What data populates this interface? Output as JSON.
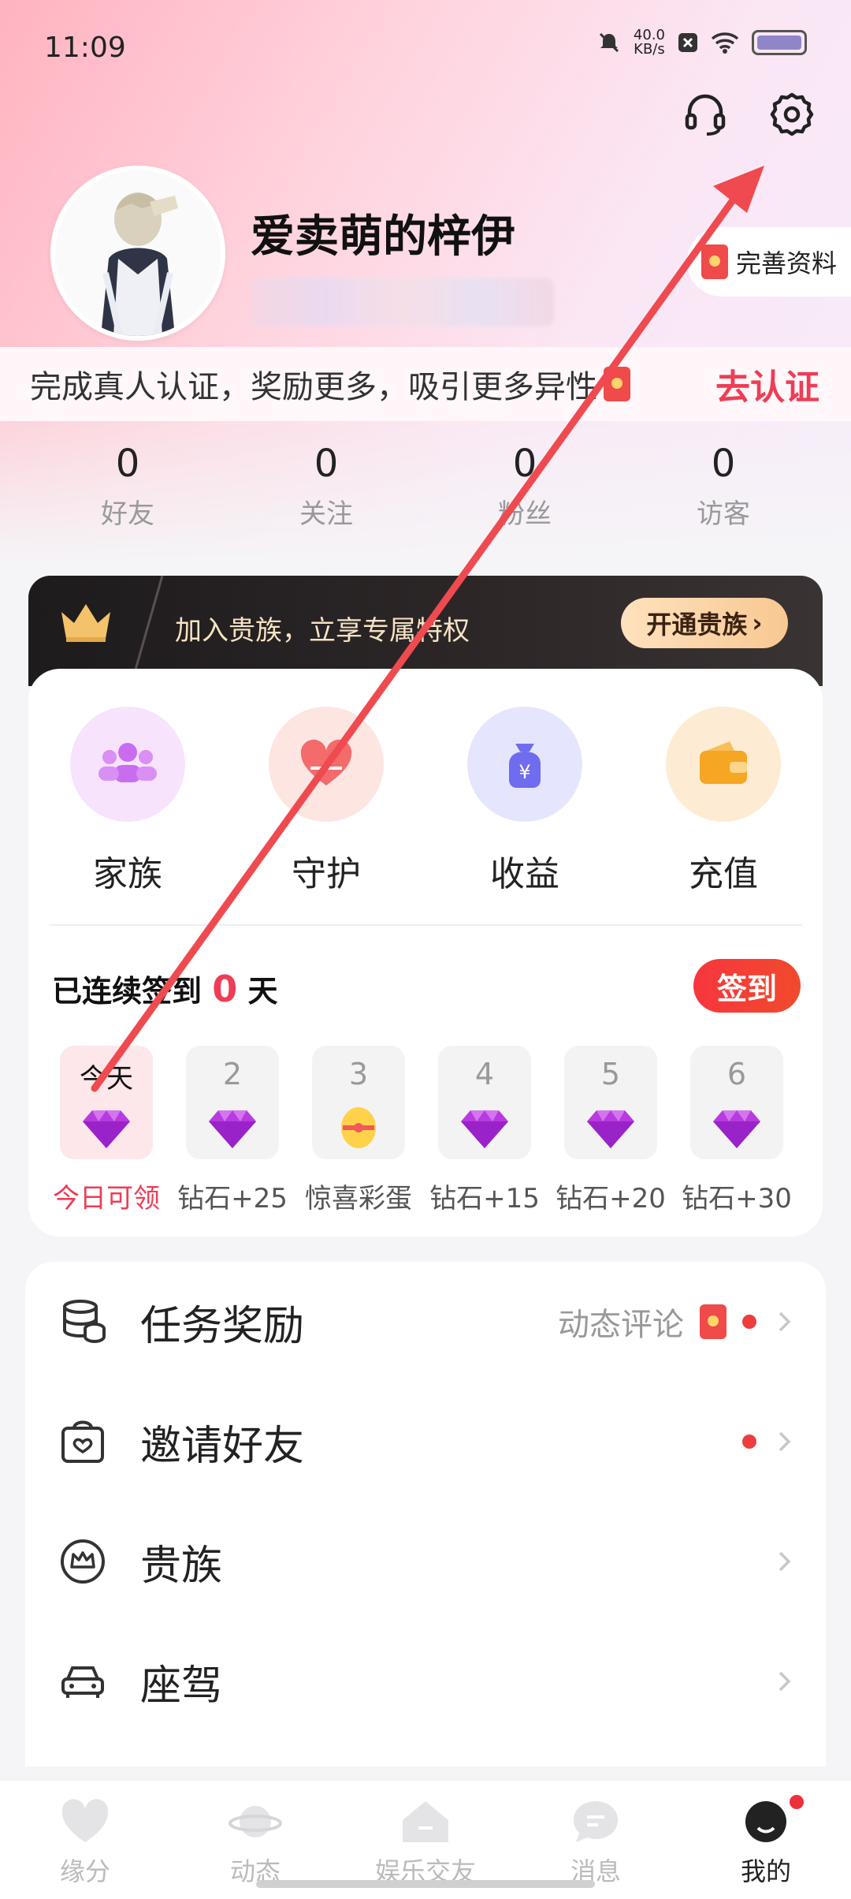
{
  "status_bar": {
    "time": "11:09",
    "net_speed_value": "40.0",
    "net_speed_unit": "KB/s"
  },
  "profile": {
    "username": "爱卖萌的梓伊",
    "complete_profile_label": "完善资料"
  },
  "verify": {
    "text": "完成真人认证，奖励更多，吸引更多异性",
    "link": "去认证"
  },
  "stats": [
    {
      "num": "0",
      "label": "好友"
    },
    {
      "num": "0",
      "label": "关注"
    },
    {
      "num": "0",
      "label": "粉丝"
    },
    {
      "num": "0",
      "label": "访客"
    }
  ],
  "noble": {
    "text": "加入贵族，立享专属特权",
    "button": "开通贵族"
  },
  "features": [
    {
      "label": "家族",
      "icon": "family-icon",
      "color": "#c96df0"
    },
    {
      "label": "守护",
      "icon": "guard-heart-icon",
      "color": "#f36b6b"
    },
    {
      "label": "收益",
      "icon": "money-bag-icon",
      "color": "#6f6cf0"
    },
    {
      "label": "充值",
      "icon": "wallet-icon",
      "color": "#f5a623"
    }
  ],
  "checkin": {
    "title_prefix": "已连续签到",
    "days_count": "0",
    "title_suffix": "天",
    "button": "签到",
    "days": [
      {
        "num": "今天",
        "label": "今日可领",
        "reward": "diamond"
      },
      {
        "num": "2",
        "label": "钻石+25",
        "reward": "diamond"
      },
      {
        "num": "3",
        "label": "惊喜彩蛋",
        "reward": "egg"
      },
      {
        "num": "4",
        "label": "钻石+15",
        "reward": "diamond"
      },
      {
        "num": "5",
        "label": "钻石+20",
        "reward": "diamond"
      },
      {
        "num": "6",
        "label": "钻石+30",
        "reward": "diamond"
      }
    ]
  },
  "menu": [
    {
      "label": "任务奖励",
      "hint": "动态评论",
      "dot": true
    },
    {
      "label": "邀请好友",
      "hint": "",
      "dot": true
    },
    {
      "label": "贵族",
      "hint": "",
      "dot": false
    },
    {
      "label": "座驾",
      "hint": "",
      "dot": false
    }
  ],
  "nav": [
    {
      "label": "缘分"
    },
    {
      "label": "动态"
    },
    {
      "label": "娱乐交友"
    },
    {
      "label": "消息"
    },
    {
      "label": "我的"
    }
  ],
  "colors": {
    "accent": "#ee3d55",
    "gold": "#f8c892",
    "diamond": "#b83be0"
  }
}
